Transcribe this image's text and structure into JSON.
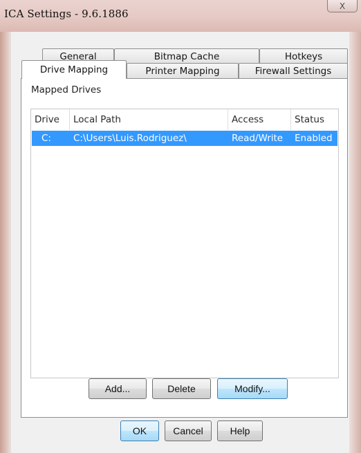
{
  "window": {
    "title": "ICA Settings - 9.6.1886",
    "close_glyph": "X"
  },
  "tabs": {
    "back_row": [
      "General",
      "Bitmap Cache",
      "Hotkeys"
    ],
    "front_row": [
      "Drive Mapping",
      "Printer Mapping",
      "Firewall Settings"
    ],
    "active": "Drive Mapping"
  },
  "mapped_drives": {
    "label": "Mapped Drives",
    "columns": [
      "Drive",
      "Local Path",
      "Access",
      "Status"
    ],
    "rows": [
      {
        "drive": "C:",
        "local_path": "C:\\Users\\Luis.Rodriguez\\",
        "access": "Read/Write",
        "status": "Enabled",
        "selected": true
      }
    ]
  },
  "panel_buttons": {
    "add": "Add...",
    "delete": "Delete",
    "modify": "Modify..."
  },
  "dialog_buttons": {
    "ok": "OK",
    "cancel": "Cancel",
    "help": "Help"
  },
  "colors": {
    "selection": "#3399ff",
    "title_bar": "#e6c9c4"
  }
}
